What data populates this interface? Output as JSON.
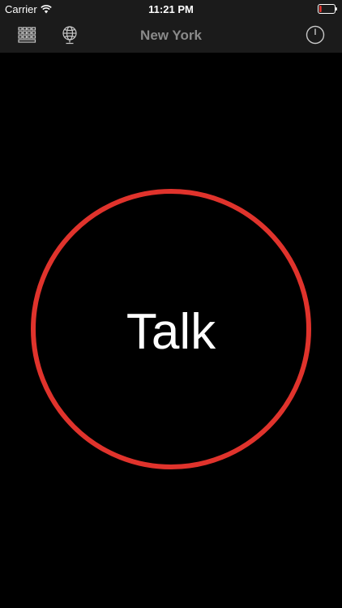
{
  "status_bar": {
    "carrier": "Carrier",
    "time": "11:21 PM",
    "wifi_icon": "wifi-icon",
    "battery_icon": "battery-low-icon",
    "battery_fill_color": "#e0332c",
    "battery_level": 0.15
  },
  "nav_bar": {
    "title": "New York",
    "left_icons": [
      "keypad-icon",
      "globe-icon"
    ],
    "right_icon": "power-icon"
  },
  "main": {
    "talk_label": "Talk",
    "ring_color": "#e0332c"
  }
}
